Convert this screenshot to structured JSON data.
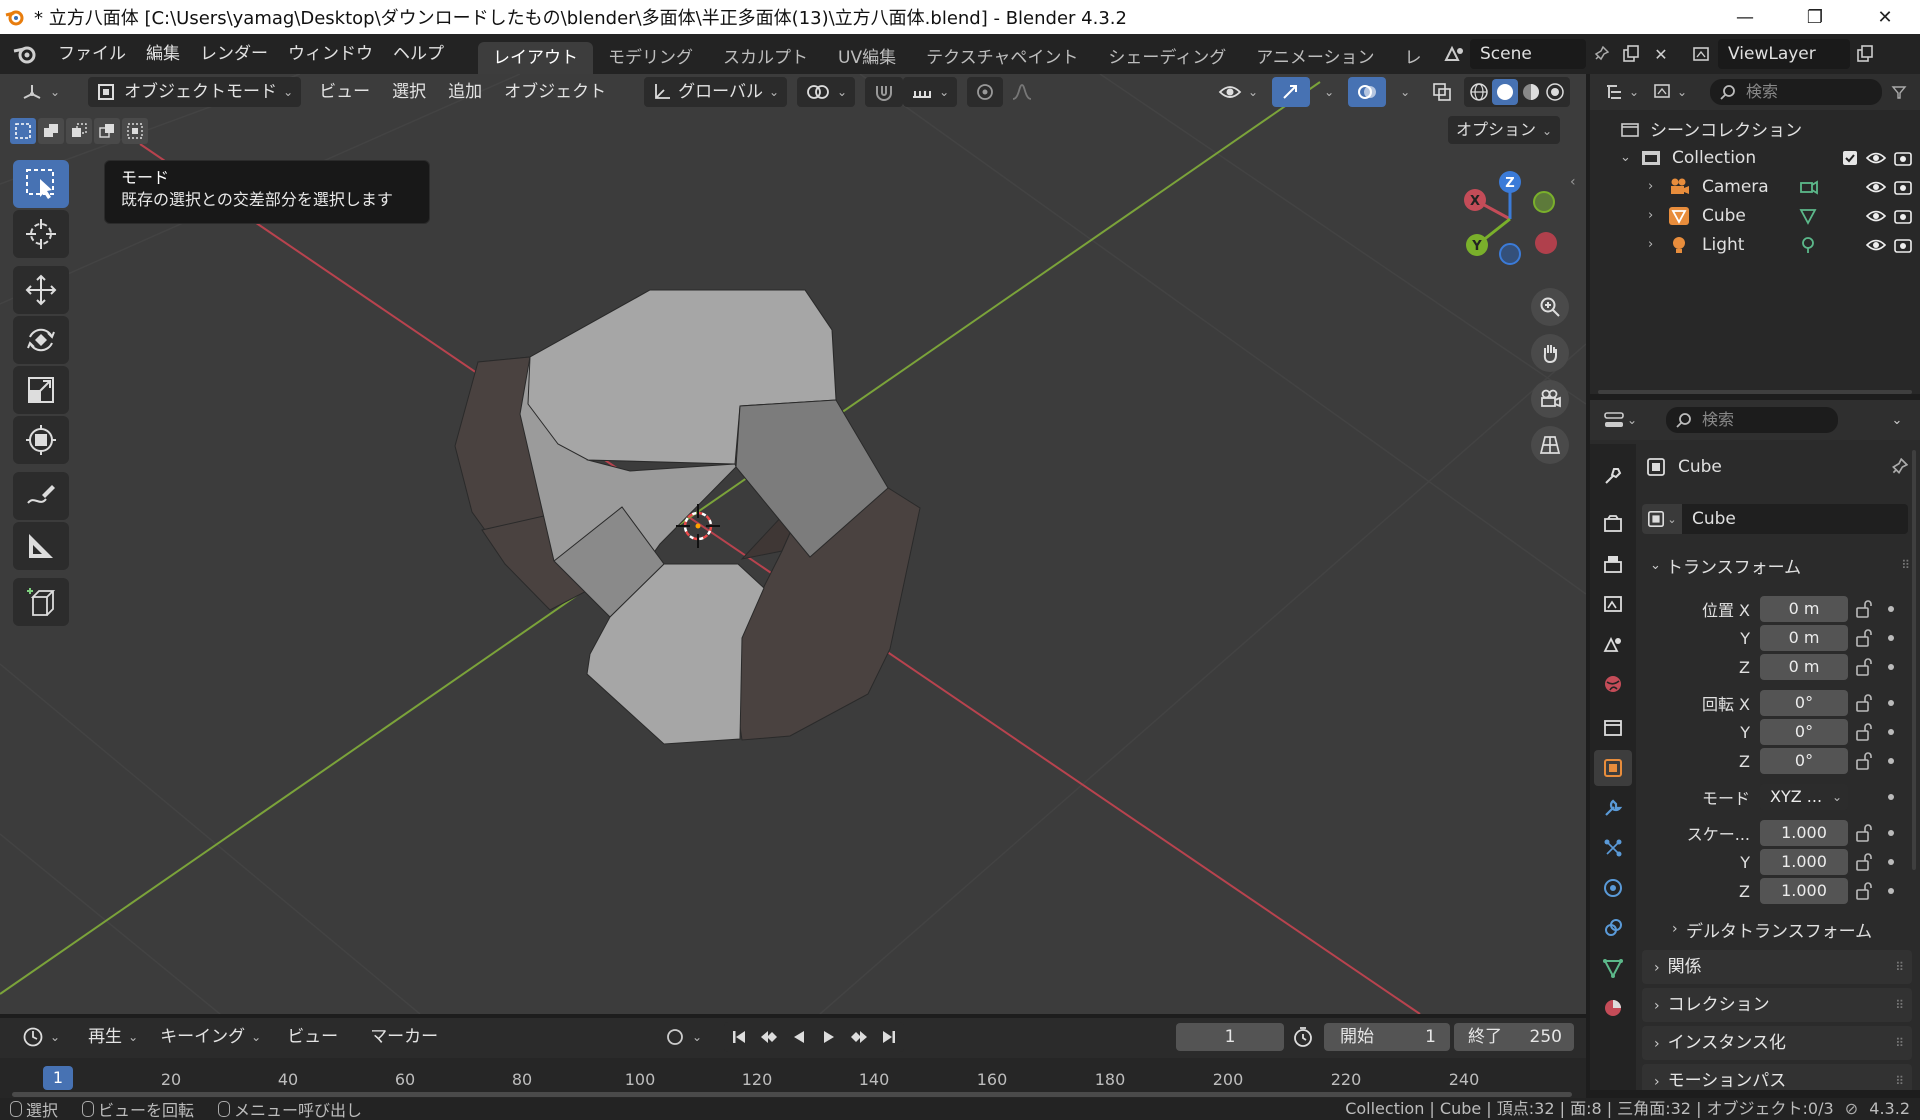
{
  "window": {
    "title": "* 立方八面体 [C:\\Users\\yamag\\Desktop\\ダウンロードしたもの\\blender\\多面体\\半正多面体(13)\\立方八面体.blend] - Blender 4.3.2",
    "controls": {
      "minimize": "—",
      "maximize": "❐",
      "close": "✕"
    }
  },
  "menubar": {
    "items": [
      "ファイル",
      "編集",
      "レンダー",
      "ウィンドウ",
      "ヘルプ"
    ],
    "workspaces": [
      "レイアウト",
      "モデリング",
      "スカルプト",
      "UV編集",
      "テクスチャペイント",
      "シェーディング",
      "アニメーション",
      "レ"
    ],
    "active_workspace": 0,
    "scene": "Scene",
    "view_layer": "ViewLayer"
  },
  "viewport_header": {
    "mode": "オブジェクトモード",
    "menus": [
      "ビュー",
      "選択",
      "追加",
      "オブジェクト"
    ],
    "orientation": "グローバル",
    "options_label": "オプション"
  },
  "tooltip": {
    "title": "モード",
    "description": "既存の選択との交差部分を選択します"
  },
  "navigation_gizmo": {
    "x": "X",
    "y": "Y",
    "z": "Z"
  },
  "outliner": {
    "search_placeholder": "検索",
    "scene_collection": "シーンコレクション",
    "collection": "Collection",
    "objects": [
      "Camera",
      "Cube",
      "Light"
    ]
  },
  "properties": {
    "search_placeholder": "検索",
    "object_name": "Cube",
    "datablock_name": "Cube",
    "transform_title": "トランスフォーム",
    "location": {
      "label_x": "位置 X",
      "label_y": "Y",
      "label_z": "Z",
      "x": "0 m",
      "y": "0 m",
      "z": "0 m"
    },
    "rotation": {
      "label_x": "回転 X",
      "label_y": "Y",
      "label_z": "Z",
      "x": "0°",
      "y": "0°",
      "z": "0°"
    },
    "mode": {
      "label": "モード",
      "value": "XYZ ..."
    },
    "scale": {
      "label_x": "スケー...",
      "label_y": "Y",
      "label_z": "Z",
      "x": "1.000",
      "y": "1.000",
      "z": "1.000"
    },
    "sections": [
      "デルタトランスフォーム",
      "関係",
      "コレクション",
      "インスタンス化",
      "モーションパス"
    ]
  },
  "timeline": {
    "menus": [
      "再生",
      "キーイング",
      "ビュー",
      "マーカー"
    ],
    "current_frame": "1",
    "start_label": "開始",
    "start": "1",
    "end_label": "終了",
    "end": "250",
    "ruler_current": "1",
    "ticks": [
      "20",
      "40",
      "60",
      "80",
      "100",
      "120",
      "140",
      "160",
      "180",
      "200",
      "220",
      "240"
    ]
  },
  "statusbar": {
    "hints": [
      "選択",
      "ビューを回転",
      "メニュー呼び出し"
    ],
    "stats": "Collection | Cube | 頂点:32 | 面:8 | 三角面:32 | オブジェクト:0/3",
    "version": "4.3.2"
  }
}
